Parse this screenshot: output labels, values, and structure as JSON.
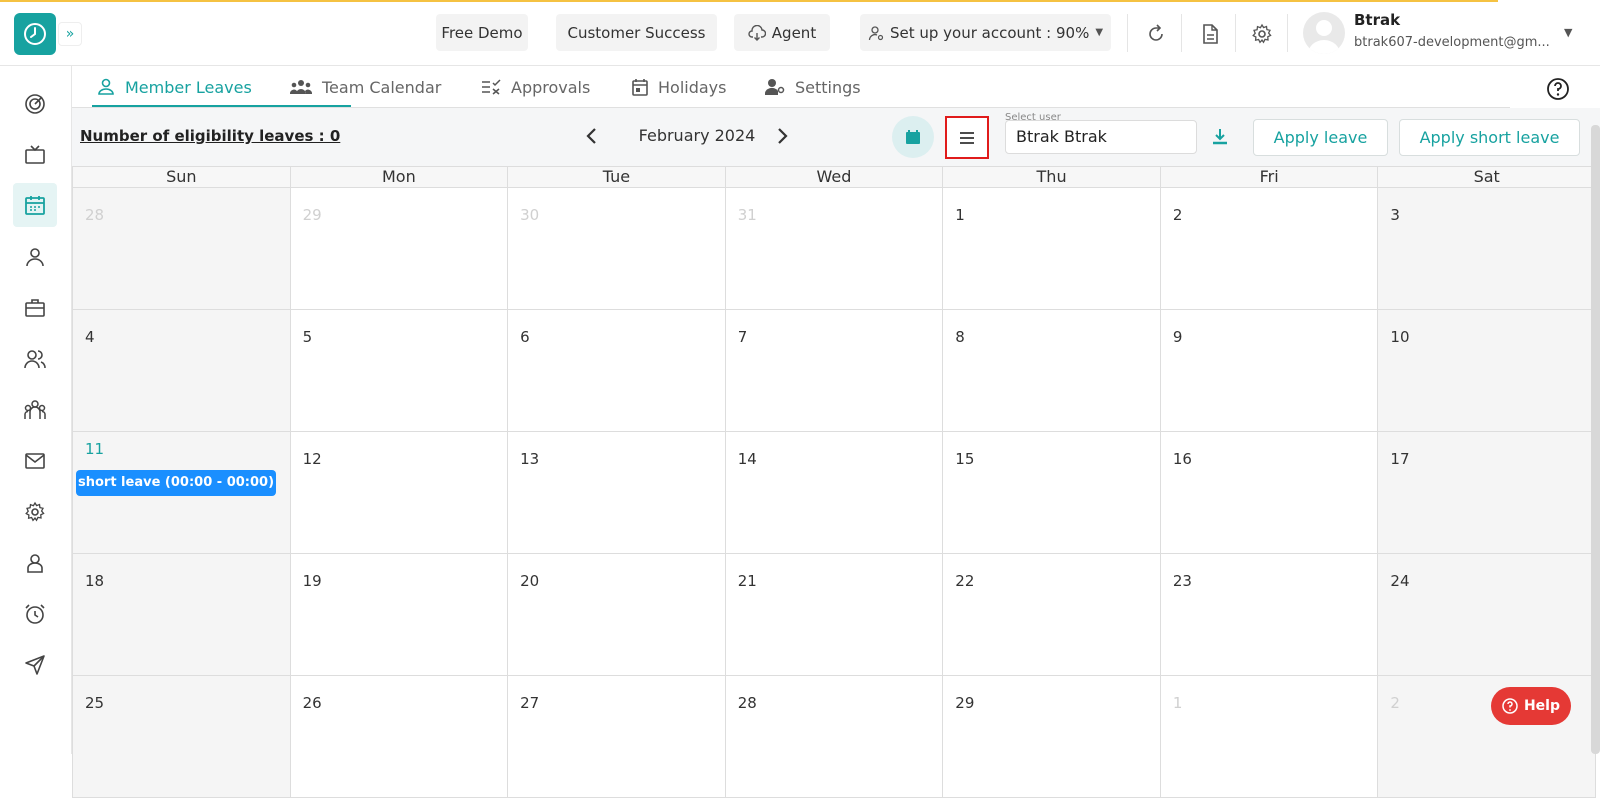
{
  "header": {
    "free_demo": "Free Demo",
    "customer_success": "Customer Success",
    "agent": "Agent",
    "setup": "Set up your account : 90%",
    "user_name": "Btrak",
    "user_email": "btrak607-development@gm..."
  },
  "tabs": [
    {
      "label": "Member Leaves",
      "icon": "user-icon"
    },
    {
      "label": "Team Calendar",
      "icon": "team-icon"
    },
    {
      "label": "Approvals",
      "icon": "approvals-icon"
    },
    {
      "label": "Holidays",
      "icon": "calendar-icon"
    },
    {
      "label": "Settings",
      "icon": "user-gear-icon"
    }
  ],
  "toolbar": {
    "eligibility": "Number of eligibility leaves : 0",
    "month": "February 2024",
    "select_user_label": "Select user",
    "select_user_value": "Btrak Btrak",
    "apply_leave": "Apply leave",
    "apply_short_leave": "Apply short leave"
  },
  "calendar": {
    "weekdays": [
      "Sun",
      "Mon",
      "Tue",
      "Wed",
      "Thu",
      "Fri",
      "Sat"
    ],
    "days": [
      "28",
      "29",
      "30",
      "31",
      "1",
      "2",
      "3",
      "4",
      "5",
      "6",
      "7",
      "8",
      "9",
      "10",
      "11",
      "12",
      "13",
      "14",
      "15",
      "16",
      "17",
      "18",
      "19",
      "20",
      "21",
      "22",
      "23",
      "24",
      "25",
      "26",
      "27",
      "28",
      "29",
      "1",
      "2"
    ],
    "event": "short leave (00:00 - 00:00)"
  },
  "help": "Help",
  "colors": {
    "accent": "#17a2a0",
    "event": "#1a8fff",
    "help": "#e53935",
    "highlight": "#e01b1b"
  }
}
